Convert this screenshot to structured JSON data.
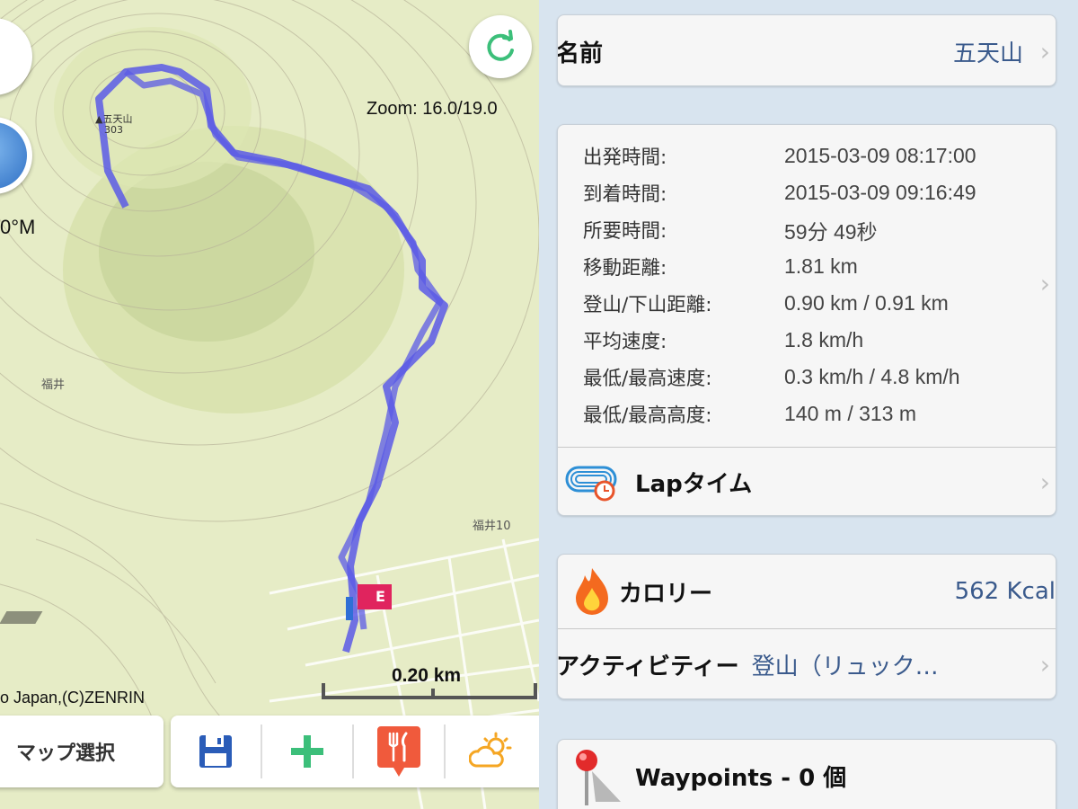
{
  "map": {
    "zoom_text": "Zoom: 16.0/19.0",
    "heading_text": "0°M",
    "peak_name": "▲五天山",
    "peak_elevation": "303",
    "place_1": "福井",
    "place_2": "福井10",
    "copyright": "o Japan,(C)ZENRIN",
    "scale_text": "0.20 km",
    "end_marker": "E",
    "map_select_label": "マップ選択",
    "toolbar_icons": [
      "save-icon",
      "add-icon",
      "restaurant-icon",
      "weather-icon"
    ],
    "colors": {
      "track": "#5b5be6",
      "start_flag": "#2f6fd6",
      "end_flag": "#e0245e",
      "add_green": "#3cbf7a",
      "refresh_green": "#3cbf7a",
      "restaurant_bg": "#f05a3c",
      "weather_orange": "#f5a623"
    }
  },
  "detail": {
    "name_label": "名前",
    "name_value": "五天山",
    "stats": [
      {
        "label": "出発時間:",
        "value": "2015-03-09 08:17:00"
      },
      {
        "label": "到着時間:",
        "value": "2015-03-09 09:16:49"
      },
      {
        "label": "所要時間:",
        "value": "59分 49秒"
      },
      {
        "label": "移動距離:",
        "value": "1.81 km"
      },
      {
        "label": "登山/下山距離:",
        "value": "0.90 km / 0.91 km"
      },
      {
        "label": "平均速度:",
        "value": "1.8 km/h"
      },
      {
        "label": "最低/最高速度:",
        "value": "0.3 km/h / 4.8 km/h"
      },
      {
        "label": "最低/最高高度:",
        "value": "140 m / 313 m"
      }
    ],
    "lap_label": "Lapタイム",
    "calorie_label": "カロリー",
    "calorie_value": "562 Kcal",
    "activity_label": "アクティビティー",
    "activity_value": "登山（リュック…",
    "waypoints_label": "Waypoints - 0 個",
    "chevron": "›"
  }
}
